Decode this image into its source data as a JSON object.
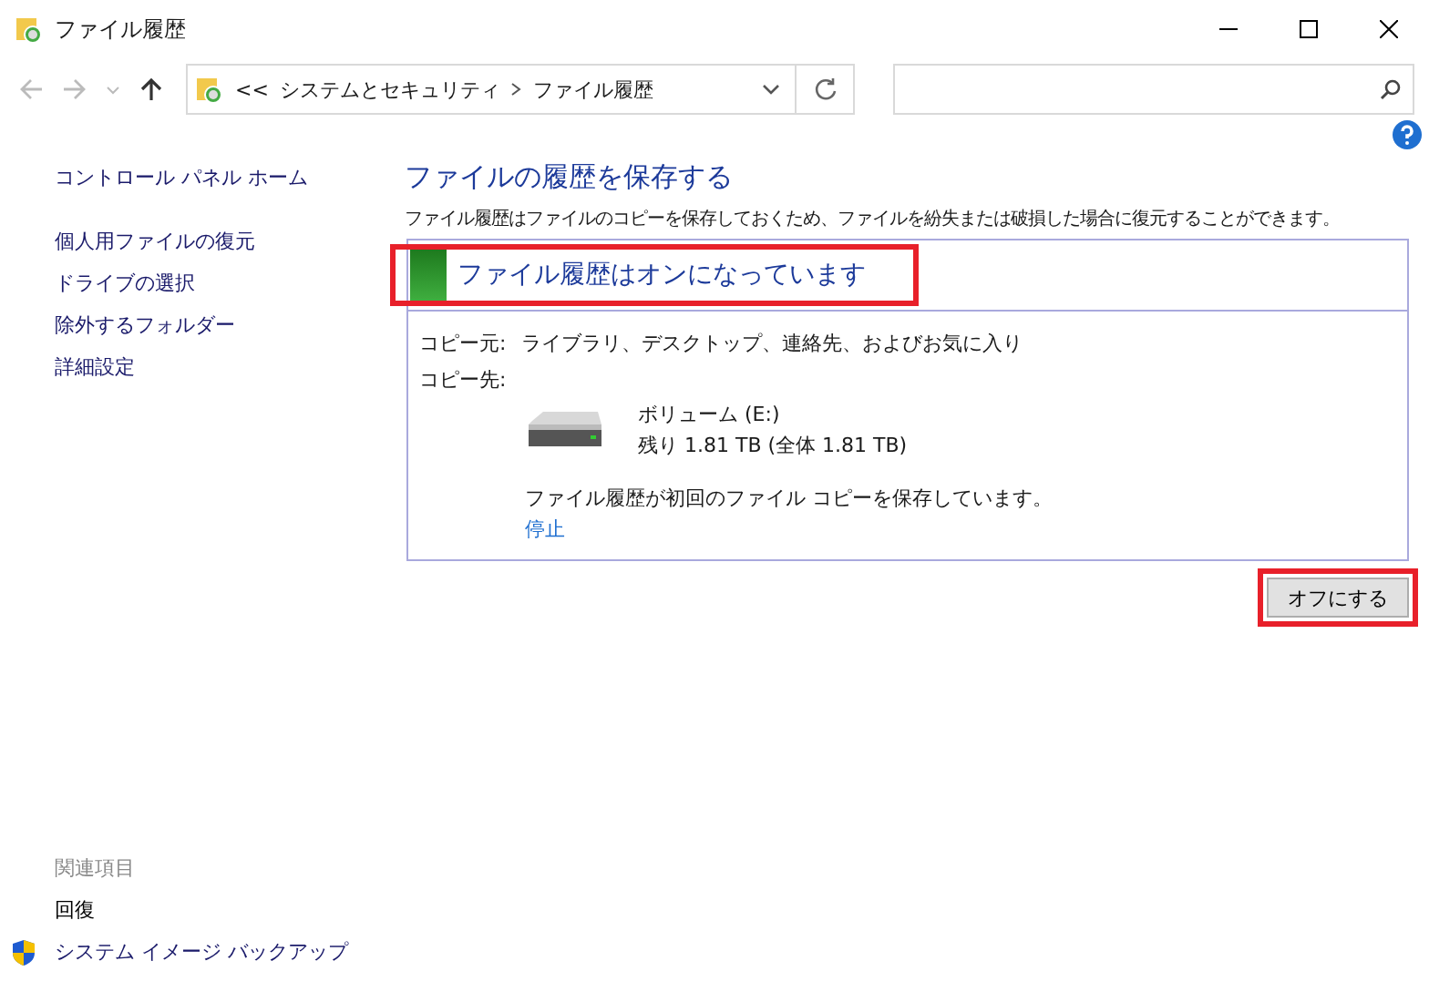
{
  "window": {
    "title": "ファイル履歴"
  },
  "address": {
    "overflow": "<<",
    "crumbs": [
      "システムとセキュリティ",
      "ファイル履歴"
    ]
  },
  "sidebar": {
    "items": [
      {
        "label": "コントロール パネル ホーム"
      },
      {
        "label": "個人用ファイルの復元"
      },
      {
        "label": "ドライブの選択"
      },
      {
        "label": "除外するフォルダー"
      },
      {
        "label": "詳細設定"
      }
    ],
    "related_heading": "関連項目",
    "related": [
      {
        "label": "回復",
        "kind": "plain"
      },
      {
        "label": "システム イメージ バックアップ",
        "kind": "shield"
      }
    ]
  },
  "main": {
    "heading": "ファイルの履歴を保存する",
    "description": "ファイル履歴はファイルのコピーを保存しておくため、ファイルを紛失または破損した場合に復元することができます。",
    "status": {
      "text": "ファイル履歴はオンになっています",
      "on": true,
      "highlighted": true
    },
    "source_label": "コピー元:",
    "source": "ライブラリ、デスクトップ、連絡先、およびお気に入り",
    "target_label": "コピー先:",
    "drive_name": "ボリューム (E:)",
    "drive_space": "残り 1.81 TB (全体 1.81 TB)",
    "progress_text": "ファイル履歴が初回のファイル コピーを保存しています。",
    "stop_link": "停止",
    "button": {
      "label": "オフにする",
      "highlighted": true
    }
  }
}
